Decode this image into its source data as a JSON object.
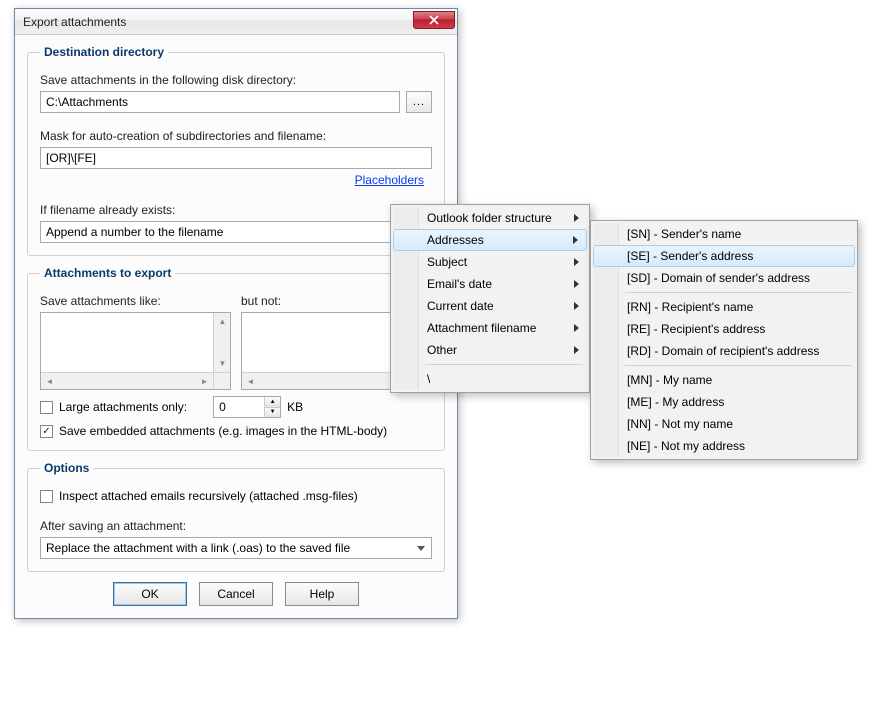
{
  "title": "Export attachments",
  "groups": {
    "destination": {
      "legend": "Destination directory",
      "saveLabel": "Save attachments in the following disk directory:",
      "savePath": "C:\\Attachments",
      "browseDots": "...",
      "maskLabel": "Mask for auto-creation of subdirectories and filename:",
      "maskValue": "[OR]\\[FE]",
      "placeholdersLink": "Placeholders",
      "existsLabel": "If filename already exists:",
      "existsValue": "Append a number to the filename"
    },
    "attachments": {
      "legend": "Attachments to export",
      "likeLabel": "Save attachments like:",
      "notLabel": "but not:",
      "largeOnlyLabel": "Large attachments only:",
      "largeOnlyChecked": false,
      "largeOnlyValue": "0",
      "kbLabel": "KB",
      "embeddedLabel": "Save embedded attachments (e.g. images in the HTML-body)",
      "embeddedChecked": true
    },
    "options": {
      "legend": "Options",
      "recursiveLabel": "Inspect attached emails recursively (attached .msg-files)",
      "recursiveChecked": false,
      "afterLabel": "After saving an attachment:",
      "afterValue": "Replace the attachment with a link (.oas) to the saved file"
    }
  },
  "buttons": {
    "ok": "OK",
    "cancel": "Cancel",
    "help": "Help"
  },
  "menu1": {
    "items": [
      {
        "label": "Outlook folder structure",
        "sub": true
      },
      {
        "label": "Addresses",
        "sub": true,
        "hover": true
      },
      {
        "label": "Subject",
        "sub": true
      },
      {
        "label": "Email's date",
        "sub": true
      },
      {
        "label": "Current date",
        "sub": true
      },
      {
        "label": "Attachment filename",
        "sub": true
      },
      {
        "label": "Other",
        "sub": true
      }
    ],
    "lastItem": "\\"
  },
  "menu2": {
    "groups": [
      [
        {
          "label": "[SN] - Sender's name"
        },
        {
          "label": "[SE] - Sender's address",
          "hover": true
        },
        {
          "label": "[SD] - Domain of sender's address"
        }
      ],
      [
        {
          "label": "[RN] - Recipient's name"
        },
        {
          "label": "[RE] - Recipient's address"
        },
        {
          "label": "[RD] - Domain of recipient's address"
        }
      ],
      [
        {
          "label": "[MN] - My name"
        },
        {
          "label": "[ME] - My address"
        },
        {
          "label": "[NN] - Not my name"
        },
        {
          "label": "[NE] - Not my address"
        }
      ]
    ]
  }
}
